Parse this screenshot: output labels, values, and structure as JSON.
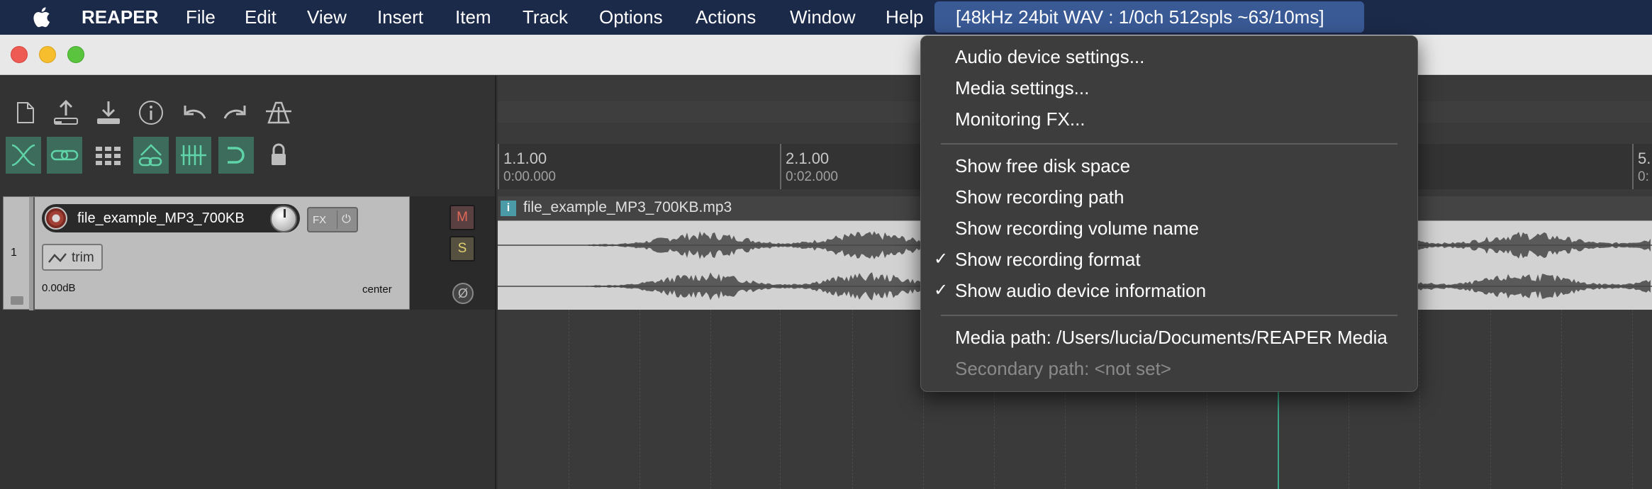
{
  "menubar": {
    "app_name": "REAPER",
    "items": [
      "File",
      "Edit",
      "View",
      "Insert",
      "Item",
      "Track",
      "Options",
      "Actions",
      "Window",
      "Help"
    ],
    "status_item": "[48kHz 24bit WAV : 1/0ch 512spls ~63/10ms]"
  },
  "dropdown": {
    "group1": [
      "Audio device settings...",
      "Media settings...",
      "Monitoring FX..."
    ],
    "group2": [
      {
        "label": "Show free disk space",
        "checked": false
      },
      {
        "label": "Show recording path",
        "checked": false
      },
      {
        "label": "Show recording volume name",
        "checked": false
      },
      {
        "label": "Show recording format",
        "checked": true
      },
      {
        "label": "Show audio device information",
        "checked": true
      }
    ],
    "media_path": "Media path: /Users/lucia/Documents/REAPER Media",
    "secondary_path": "Secondary path: <not set>",
    "check_glyph": "✓"
  },
  "toolbar": {
    "row1_icons": [
      "new-project-icon",
      "open-project-icon",
      "save-project-icon",
      "project-info-icon",
      "undo-icon",
      "redo-icon",
      "metronome-icon"
    ],
    "row2_icons": [
      "ripple-edit-icon",
      "grouping-icon",
      "grid-icon",
      "envelope-link-icon",
      "snap-icon",
      "loop-icon",
      "lock-icon"
    ]
  },
  "track": {
    "number": "1",
    "name": "file_example_MP3_700KB",
    "fx_label": "FX",
    "trim_label": "trim",
    "volume": "0.00dB",
    "pan": "center",
    "mute_label": "M",
    "solo_label": "S",
    "phase_label": "Ø"
  },
  "ruler": {
    "markers": [
      {
        "bar": "1.1.00",
        "time": "0:00.000"
      },
      {
        "bar": "2.1.00",
        "time": "0:02.000"
      },
      {
        "bar": "5.",
        "time": "0:"
      }
    ]
  },
  "item": {
    "icon_label": "i",
    "name": "file_example_MP3_700KB.mp3"
  },
  "colors": {
    "menubar_bg": "#1c2a4a",
    "status_highlight": "#3a5a96",
    "toolbar_active": "#3d6b5c",
    "cursor": "#3aa88a"
  }
}
